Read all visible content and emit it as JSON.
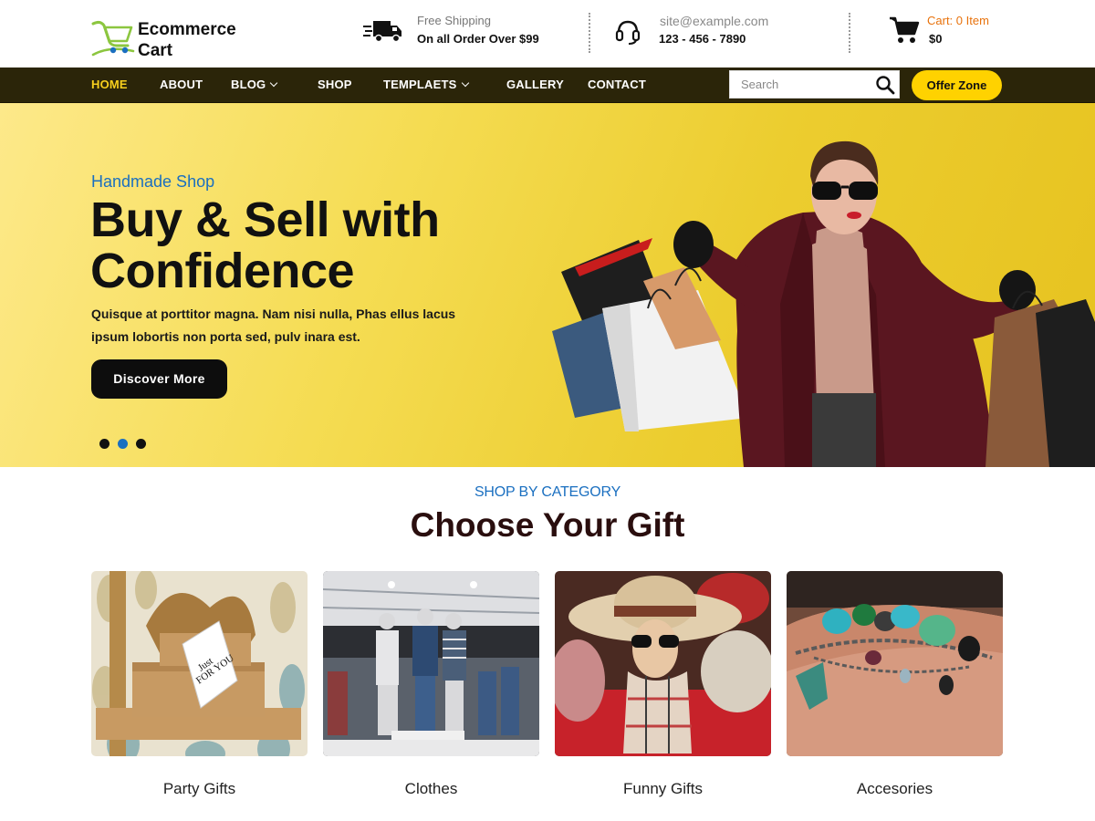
{
  "brand": {
    "line1": "Ecommerce",
    "line2": "Cart",
    "icon": "cart-logo-icon"
  },
  "header": {
    "shipping": {
      "title": "Free Shipping",
      "detail": "On all Order Over $99",
      "icon": "truck-icon"
    },
    "contact": {
      "email": "site@example.com",
      "phone": "123 - 456 - 7890",
      "icon": "headset-icon"
    },
    "cart": {
      "label": "Cart: 0 Item",
      "total": "$0",
      "icon": "cart-icon"
    }
  },
  "nav": {
    "items": [
      {
        "label": "HOME",
        "active": true
      },
      {
        "label": "ABOUT"
      },
      {
        "label": "BLOG",
        "dropdown": true
      },
      {
        "label": "SHOP"
      },
      {
        "label": "TEMPLAETS",
        "dropdown": true
      },
      {
        "label": "GALLERY"
      },
      {
        "label": "CONTACT"
      }
    ],
    "search_placeholder": "Search",
    "offer_label": "Offer Zone"
  },
  "hero": {
    "subtitle": "Handmade Shop",
    "title_line1": "Buy & Sell with",
    "title_line2": "Confidence",
    "desc": "Quisque at porttitor magna. Nam nisi nulla, Phas ellus lacus ipsum lobortis non porta sed, pulv inara est.",
    "button": "Discover More",
    "slides": 3,
    "active_slide": 2
  },
  "categories": {
    "subtitle": "SHOP BY CATEGORY",
    "title": "Choose Your Gift",
    "items": [
      {
        "label": "Party Gifts"
      },
      {
        "label": "Clothes"
      },
      {
        "label": "Funny Gifts"
      },
      {
        "label": "Accesories"
      }
    ]
  },
  "colors": {
    "accent_yellow": "#ffd200",
    "nav_bg": "#2b2509",
    "link_blue": "#1a6fc0",
    "cart_orange": "#e8720c"
  }
}
